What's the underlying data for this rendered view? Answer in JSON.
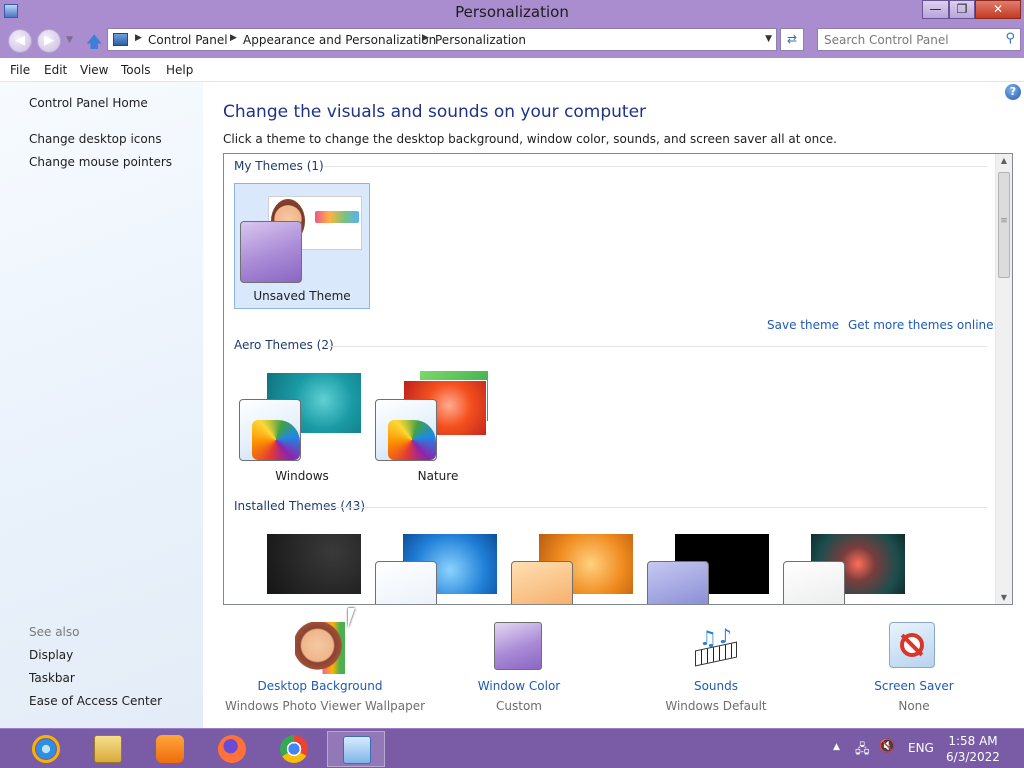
{
  "window": {
    "title": "Personalization",
    "minimize_glyph": "—",
    "maximize_glyph": "❐",
    "close_glyph": "✕"
  },
  "address": {
    "breadcrumbs": [
      "Control Panel",
      "Appearance and Personalization",
      "Personalization"
    ],
    "search_placeholder": "Search Control Panel"
  },
  "menu": [
    "File",
    "Edit",
    "View",
    "Tools",
    "Help"
  ],
  "sidebar": {
    "links": [
      "Control Panel Home",
      "Change desktop icons",
      "Change mouse pointers"
    ],
    "see_also_title": "See also",
    "see_also_links": [
      "Display",
      "Taskbar",
      "Ease of Access Center"
    ]
  },
  "main": {
    "heading": "Change the visuals and sounds on your computer",
    "subtext": "Click a theme to change the desktop background, window color, sounds, and screen saver all at once.",
    "groups": {
      "my_themes": "My Themes (1)",
      "aero_themes": "Aero Themes (2)",
      "installed_themes": "Installed Themes (43)"
    },
    "my_themes": [
      {
        "name": "Unsaved Theme",
        "selected": true
      }
    ],
    "actions": {
      "save_theme": "Save theme",
      "get_more": "Get more themes online"
    },
    "aero_themes": [
      {
        "name": "Windows"
      },
      {
        "name": "Nature"
      }
    ],
    "installed_theme_count_visible": 5,
    "help_glyph": "?"
  },
  "settings": [
    {
      "label": "Desktop Background",
      "value": "Windows Photo Viewer Wallpaper",
      "icon": "desktop-background-icon"
    },
    {
      "label": "Window Color",
      "value": "Custom",
      "icon": "window-color-icon"
    },
    {
      "label": "Sounds",
      "value": "Windows Default",
      "icon": "sounds-icon"
    },
    {
      "label": "Screen Saver",
      "value": "None",
      "icon": "screen-saver-icon"
    }
  ],
  "taskbar": {
    "apps": [
      "internet-explorer-icon",
      "file-explorer-icon",
      "uc-browser-icon",
      "firefox-icon",
      "chrome-icon",
      "control-panel-icon"
    ],
    "language": "ENG",
    "time": "1:58 AM",
    "date": "6/3/2022"
  },
  "colors": {
    "accent_purple": "#a98dce",
    "taskbar_purple": "#7a5ba6",
    "link_blue": "#1e5ab4",
    "heading_blue": "#1e3287",
    "selected_tile": "#d9e8fb"
  }
}
